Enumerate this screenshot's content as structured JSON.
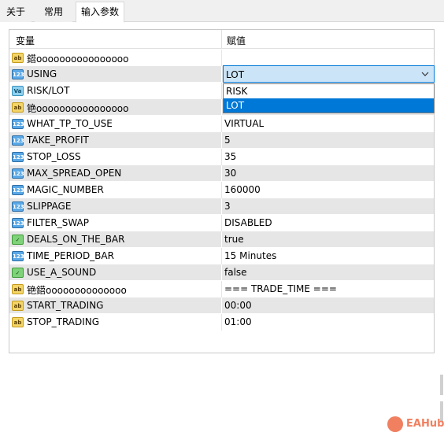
{
  "tabs": [
    {
      "label": "关于"
    },
    {
      "label": "常用"
    },
    {
      "label": "输入参数"
    }
  ],
  "grid": {
    "col_variable": "变量",
    "col_value": "赋值"
  },
  "rows": [
    {
      "icon": "ab",
      "name": "鍣oooooooooooooooo",
      "value": ""
    },
    {
      "icon": "num",
      "name": "USING",
      "value": ""
    },
    {
      "icon": "va",
      "name": "RISK/LOT",
      "value": ""
    },
    {
      "icon": "ab",
      "name": "铯oooooooooooooooo",
      "value": ""
    },
    {
      "icon": "num",
      "name": "WHAT_TP_TO_USE",
      "value": "VIRTUAL"
    },
    {
      "icon": "num",
      "name": "TAKE_PROFIT",
      "value": "5"
    },
    {
      "icon": "num",
      "name": "STOP_LOSS",
      "value": "35"
    },
    {
      "icon": "num",
      "name": "MAX_SPREAD_OPEN",
      "value": "30"
    },
    {
      "icon": "num",
      "name": "MAGIC_NUMBER",
      "value": "160000"
    },
    {
      "icon": "num",
      "name": "SLIPPAGE",
      "value": "3"
    },
    {
      "icon": "num",
      "name": "FILTER_SWAP",
      "value": "DISABLED"
    },
    {
      "icon": "bool",
      "name": "DEALS_ON_THE_BAR",
      "value": "true"
    },
    {
      "icon": "num",
      "name": "TIME_PERIOD_BAR",
      "value": "15 Minutes"
    },
    {
      "icon": "bool",
      "name": "USE_A_SOUND",
      "value": "false"
    },
    {
      "icon": "ab",
      "name": "铯鍣oooooooooooooo",
      "value": "=== TRADE_TIME ==="
    },
    {
      "icon": "ab",
      "name": "START_TRADING",
      "value": "00:00"
    },
    {
      "icon": "ab",
      "name": "STOP_TRADING",
      "value": "01:00"
    }
  ],
  "dropdown": {
    "selected": "LOT",
    "options": [
      "RISK",
      "LOT"
    ],
    "highlighted_index": 1
  },
  "icon_labels": {
    "ab": "ab",
    "num": "123",
    "va": "Va",
    "bool": "✓"
  },
  "watermark": {
    "text": "EAHub"
  },
  "colors": {
    "accent": "#0078d7",
    "alt_row": "#e6e6e6",
    "combo_bg": "#cce4f7"
  }
}
